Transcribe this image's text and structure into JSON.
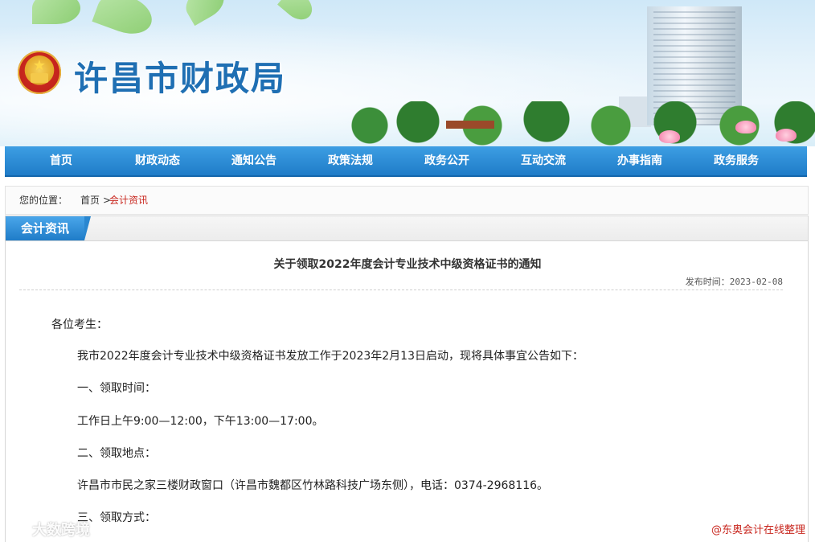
{
  "header": {
    "site_title": "许昌市财政局",
    "emblem_icon": "national-emblem-icon"
  },
  "nav": {
    "items": [
      "首页",
      "财政动态",
      "通知公告",
      "政策法规",
      "政务公开",
      "互动交流",
      "办事指南",
      "政务服务"
    ]
  },
  "breadcrumb": {
    "label": "您的位置：",
    "home": "首页",
    "separator": ">",
    "current": "会计资讯"
  },
  "section": {
    "title": "会计资讯"
  },
  "article": {
    "title": "关于领取2022年度会计专业技术中级资格证书的通知",
    "publish_label": "发布时间：",
    "publish_date": "2023-02-08",
    "paragraphs": [
      "各位考生：",
      "我市2022年度会计专业技术中级资格证书发放工作于2023年2月13日启动，现将具体事宜公告如下：",
      "一、领取时间：",
      "工作日上午9:00—12:00，下午13:00—17:00。",
      "二、领取地点：",
      "许昌市市民之家三楼财政窗口（许昌市魏都区竹林路科技广场东侧），电话：0374-2968116。",
      "三、领取方式："
    ]
  },
  "watermarks": {
    "left": "大数跨境",
    "right": "@东奥会计在线整理"
  },
  "colors": {
    "nav_blue": "#1f7cc8",
    "accent_red": "#c8261e",
    "title_blue": "#1f6fb3"
  }
}
